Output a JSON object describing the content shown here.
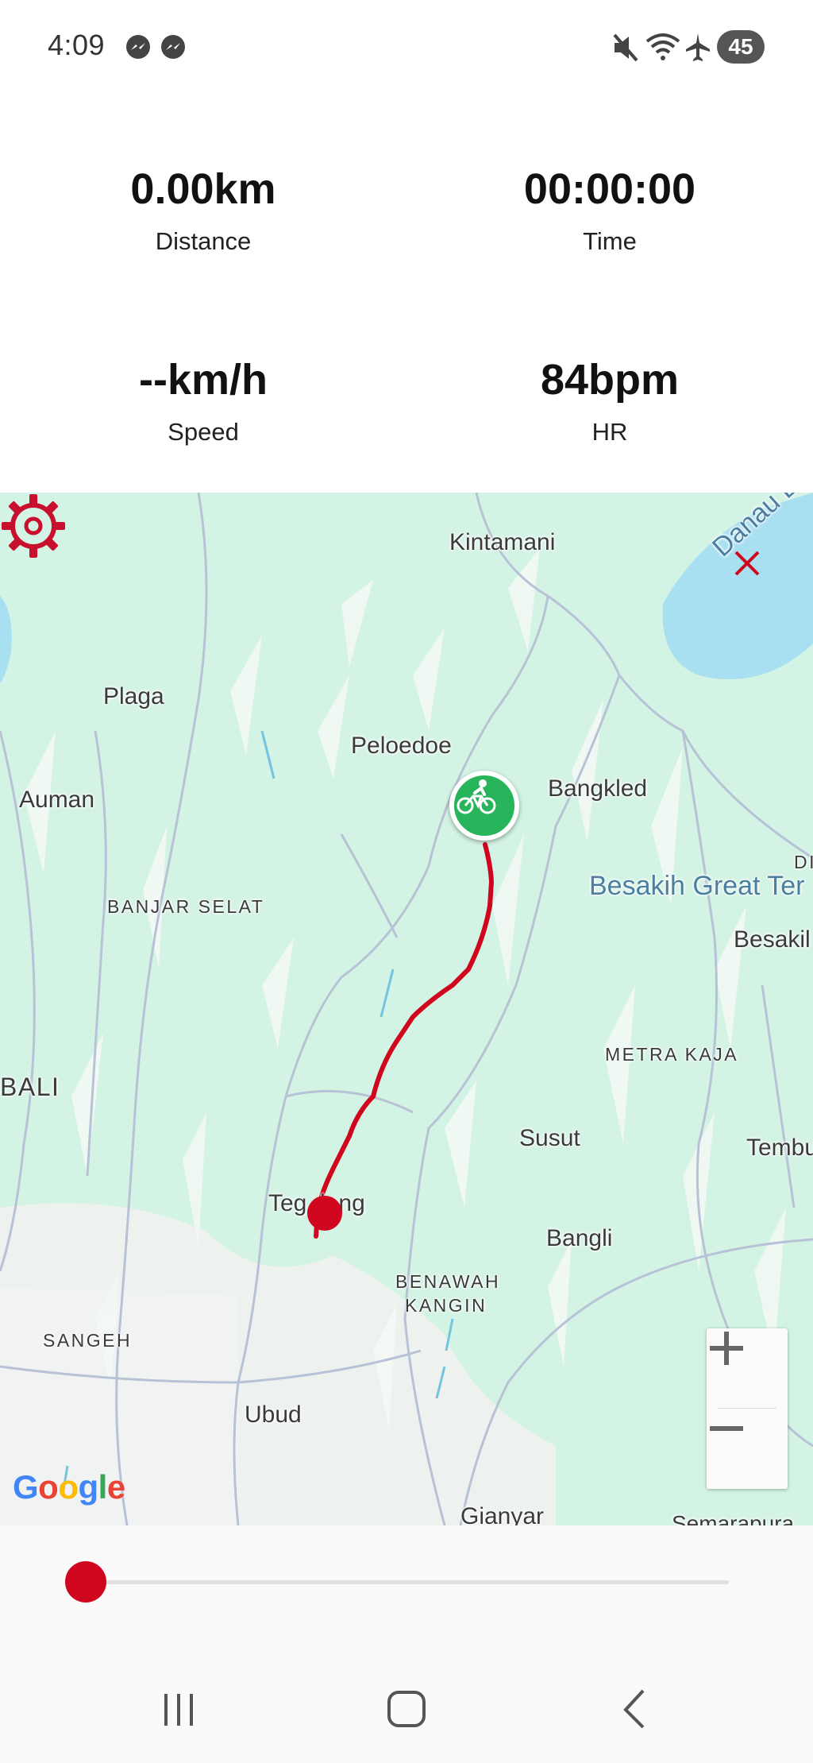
{
  "status_bar": {
    "time": "4:09",
    "battery": "45",
    "left_icons": [
      "messenger-icon",
      "messenger-icon"
    ],
    "right_icons": [
      "mute-icon",
      "wifi-icon",
      "airplane-icon",
      "battery-icon"
    ]
  },
  "stats": {
    "distance": {
      "value": "0.00km",
      "label": "Distance"
    },
    "time": {
      "value": "00:00:00",
      "label": "Time"
    },
    "speed": {
      "value": "--km/h",
      "label": "Speed"
    },
    "hr": {
      "value": "84bpm",
      "label": "HR"
    }
  },
  "map": {
    "labels": {
      "kintamani": "Kintamani",
      "danau_batur": "Danau Batur",
      "plaga": "Plaga",
      "peloedoe": "Peloedoe",
      "auman": "Auman",
      "bangkled": "Bangkled",
      "di": "DI",
      "banjar_selat": "BANJAR SELAT",
      "besakih_great": "Besakih Great Ter",
      "besakih": "Besakil",
      "metra_kaja": "METRA KAJA",
      "bali": "BALI",
      "susut": "Susut",
      "tembu": "Tembu",
      "tegallalang": "Teg  lang",
      "bangli": "Bangli",
      "benawah": "BENAWAH",
      "kangin": "KANGIN",
      "sangeh": "SANGEH",
      "ubud": "Ubud",
      "gianyar": "Gianyar",
      "semarapura": "Semarapura"
    },
    "google_logo": "Google",
    "route_color": "#d0061e",
    "marker_color": "#27b45a",
    "land_color": "#d3f3e4",
    "water_color": "#a8dff1",
    "controls": {
      "settings": "gear-icon",
      "zoom_in": "+",
      "zoom_out": "−"
    }
  },
  "playback": {
    "progress": 0
  },
  "nav": {
    "buttons": [
      "recents-icon",
      "home-icon",
      "back-icon"
    ]
  }
}
